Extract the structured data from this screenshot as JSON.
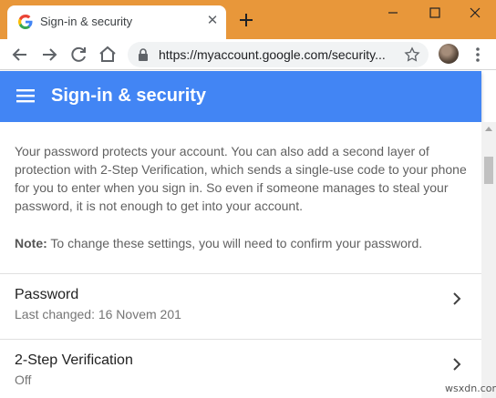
{
  "browser": {
    "tab_title": "Sign-in & security",
    "tab_close_glyph": "✕",
    "url": "https://myaccount.google.com/security...",
    "icons": {
      "favicon": "google-g-icon",
      "new_tab": "plus-icon",
      "back": "arrow-left-icon",
      "forward": "arrow-right-icon",
      "reload": "reload-icon",
      "home": "home-icon",
      "lock": "lock-icon",
      "bookmark": "star-icon",
      "profile": "avatar",
      "menu": "more-vert-icon"
    },
    "colors": {
      "titlebar": "#e8973a",
      "omnibox": "#f1f3f4"
    }
  },
  "header": {
    "title": "Sign-in & security",
    "color": "#4285f4"
  },
  "content": {
    "intro": "Your password protects your account. You can also add a second layer of protection with 2-Step Verification, which sends a single-use code to your phone for you to enter when you sign in. So even if someone manages to steal your password, it is not enough to get into your account.",
    "note_label": "Note:",
    "note_text": "To change these settings, you will need to confirm your password.",
    "rows": [
      {
        "title": "Password",
        "subtitle": "Last changed: 16 Novem   201  "
      },
      {
        "title": "2-Step Verification",
        "subtitle": "Off"
      }
    ]
  },
  "watermark": "wsxdn.com"
}
